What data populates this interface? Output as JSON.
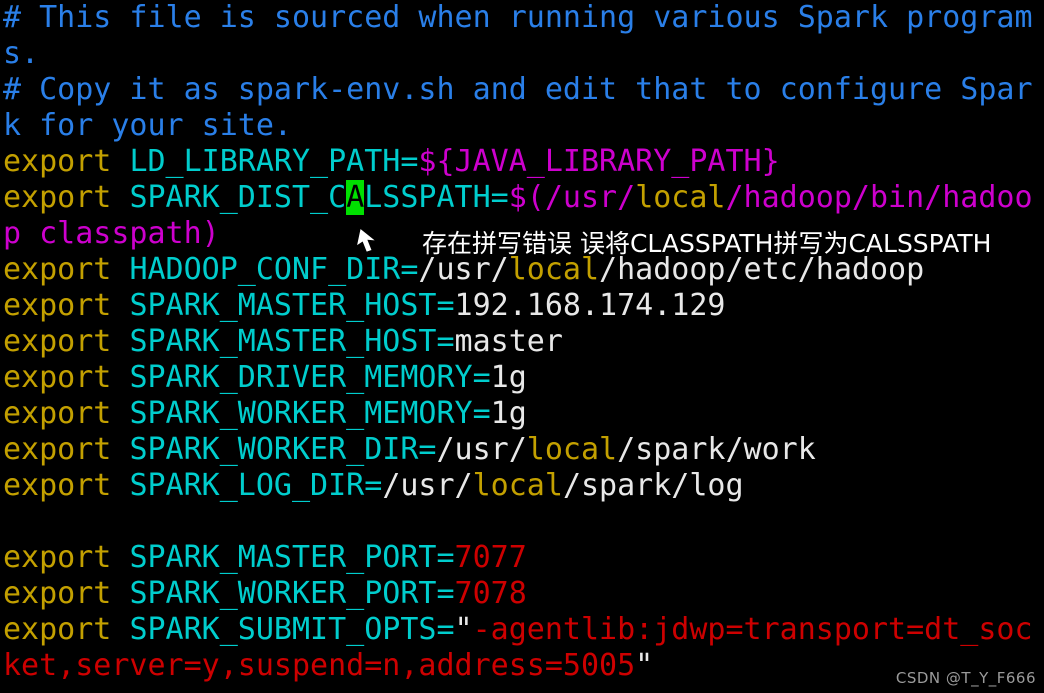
{
  "terminal": {
    "background_color": "#000000",
    "font_size_px": 30,
    "line_height_px": 36,
    "columns": 51,
    "colors": {
      "comment": "#2a7fe8",
      "keyword": "#c3a000",
      "variable": "#00cdcd",
      "value": "#e8e8e8",
      "path": "#cd00cd",
      "local": "#c3a000",
      "number": "#cd0000",
      "cursor_bg": "#00e000",
      "cursor_fg": "#000000",
      "annotation": "#ffffff",
      "watermark": "#9a9a9a"
    },
    "lines": [
      {
        "id": "line-1",
        "segments": [
          {
            "text": "# This file is sourced when running various Spark program",
            "style": "c-comment"
          }
        ]
      },
      {
        "id": "line-2",
        "segments": [
          {
            "text": "s.",
            "style": "c-comment"
          }
        ]
      },
      {
        "id": "line-3",
        "segments": [
          {
            "text": "# Copy it as spark-env.sh and edit that to configure Spar",
            "style": "c-comment"
          }
        ]
      },
      {
        "id": "line-4",
        "segments": [
          {
            "text": "k for your site.",
            "style": "c-comment"
          }
        ]
      },
      {
        "id": "line-5",
        "segments": [
          {
            "text": "export ",
            "style": "c-keyword"
          },
          {
            "text": "LD_LIBRARY_PATH=",
            "style": "c-var"
          },
          {
            "text": "${JAVA_LIBRARY_PATH}",
            "style": "c-magenta"
          }
        ]
      },
      {
        "id": "line-6",
        "segments": [
          {
            "text": "export ",
            "style": "c-keyword"
          },
          {
            "text": "SPARK_DIST_C",
            "style": "c-var"
          },
          {
            "text": "A",
            "style": "c-cursor"
          },
          {
            "text": "LSSPATH=",
            "style": "c-var"
          },
          {
            "text": "$(/usr/",
            "style": "c-magenta"
          },
          {
            "text": "local",
            "style": "c-yellow"
          },
          {
            "text": "/hadoop/bin/hadoo",
            "style": "c-magenta"
          }
        ]
      },
      {
        "id": "line-7",
        "segments": [
          {
            "text": "p classpath)",
            "style": "c-magenta"
          }
        ]
      },
      {
        "id": "line-8",
        "segments": [
          {
            "text": "export ",
            "style": "c-keyword"
          },
          {
            "text": "HADOOP_CONF_DIR=",
            "style": "c-var"
          },
          {
            "text": "/usr/",
            "style": "c-white"
          },
          {
            "text": "local",
            "style": "c-yellow"
          },
          {
            "text": "/hadoop/etc/hadoop",
            "style": "c-white"
          }
        ]
      },
      {
        "id": "line-9",
        "segments": [
          {
            "text": "export ",
            "style": "c-keyword"
          },
          {
            "text": "SPARK_MASTER_HOST=",
            "style": "c-var"
          },
          {
            "text": "192.168.174.129",
            "style": "c-white"
          }
        ]
      },
      {
        "id": "line-10",
        "segments": [
          {
            "text": "export ",
            "style": "c-keyword"
          },
          {
            "text": "SPARK_MASTER_HOST=",
            "style": "c-var"
          },
          {
            "text": "master",
            "style": "c-white"
          }
        ]
      },
      {
        "id": "line-11",
        "segments": [
          {
            "text": "export ",
            "style": "c-keyword"
          },
          {
            "text": "SPARK_DRIVER_MEMORY=",
            "style": "c-var"
          },
          {
            "text": "1g",
            "style": "c-white"
          }
        ]
      },
      {
        "id": "line-12",
        "segments": [
          {
            "text": "export ",
            "style": "c-keyword"
          },
          {
            "text": "SPARK_WORKER_MEMORY=",
            "style": "c-var"
          },
          {
            "text": "1g",
            "style": "c-white"
          }
        ]
      },
      {
        "id": "line-13",
        "segments": [
          {
            "text": "export ",
            "style": "c-keyword"
          },
          {
            "text": "SPARK_WORKER_DIR=",
            "style": "c-var"
          },
          {
            "text": "/usr/",
            "style": "c-white"
          },
          {
            "text": "local",
            "style": "c-yellow"
          },
          {
            "text": "/spark/work",
            "style": "c-white"
          }
        ]
      },
      {
        "id": "line-14",
        "segments": [
          {
            "text": "export ",
            "style": "c-keyword"
          },
          {
            "text": "SPARK_LOG_DIR=",
            "style": "c-var"
          },
          {
            "text": "/usr/",
            "style": "c-white"
          },
          {
            "text": "local",
            "style": "c-yellow"
          },
          {
            "text": "/spark/log",
            "style": "c-white"
          }
        ]
      },
      {
        "id": "line-15",
        "segments": [
          {
            "text": " ",
            "style": "c-white"
          }
        ]
      },
      {
        "id": "line-16",
        "segments": [
          {
            "text": "export ",
            "style": "c-keyword"
          },
          {
            "text": "SPARK_MASTER_PORT=",
            "style": "c-var"
          },
          {
            "text": "7077",
            "style": "c-red"
          }
        ]
      },
      {
        "id": "line-17",
        "segments": [
          {
            "text": "export ",
            "style": "c-keyword"
          },
          {
            "text": "SPARK_WORKER_PORT=",
            "style": "c-var"
          },
          {
            "text": "7078",
            "style": "c-red"
          }
        ]
      },
      {
        "id": "line-18",
        "segments": [
          {
            "text": "export ",
            "style": "c-keyword"
          },
          {
            "text": "SPARK_SUBMIT_OPTS=",
            "style": "c-var"
          },
          {
            "text": "\"",
            "style": "c-white"
          },
          {
            "text": "-agentlib:jdwp=transport=dt_soc",
            "style": "c-red"
          }
        ]
      },
      {
        "id": "line-19",
        "segments": [
          {
            "text": "ket,server=y,suspend=n,address=5005",
            "style": "c-red"
          },
          {
            "text": "\"",
            "style": "c-white"
          }
        ]
      }
    ]
  },
  "annotation": {
    "text": "存在拼写错误 误将CLASSPATH拼写为CALSSPATH",
    "pointer_icon": "arrow-cursor-icon"
  },
  "watermark": {
    "text": "CSDN @T_Y_F666"
  }
}
